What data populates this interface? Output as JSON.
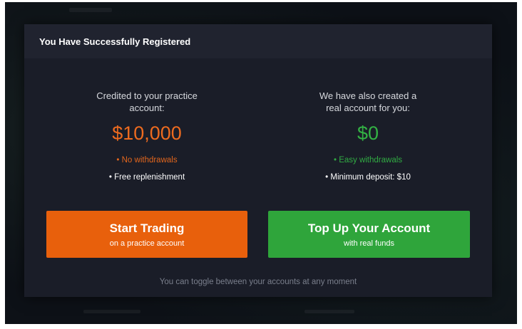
{
  "modal": {
    "title": "You Have Successfully Registered",
    "practice": {
      "credited_line1": "Credited to your practice",
      "credited_line2": "account:",
      "amount": "$10,000",
      "feature1": "• No withdrawals",
      "feature2": "• Free replenishment"
    },
    "real": {
      "credited_line1": "We have also created a",
      "credited_line2": "real account for you:",
      "amount": "$0",
      "feature1": "• Easy withdrawals",
      "feature2": "• Minimum deposit: $10"
    },
    "buttons": {
      "start_label": "Start Trading",
      "start_sub": "on a practice account",
      "topup_label": "Top Up Your Account",
      "topup_sub": "with real funds"
    },
    "footer": "You can toggle between your accounts at any moment"
  },
  "colors": {
    "orange": "#e8600c",
    "green": "#2fa53b",
    "modal_bg": "#1a1d28",
    "header_bg": "#20232f"
  }
}
